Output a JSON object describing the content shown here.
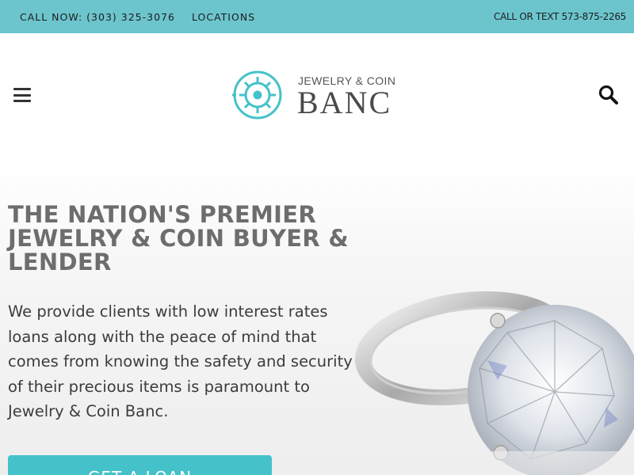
{
  "topbar": {
    "call_now": "CALL NOW: (303) 325-3076",
    "locations": "LOCATIONS",
    "call_or_text": "CALL OR TEXT 573-875-2265"
  },
  "header": {
    "logo_top": "JEWELRY & COIN",
    "logo_main": "BANC",
    "menu_icon": "hamburger-menu-icon",
    "search_icon": "magnifier-icon"
  },
  "hero": {
    "title": "THE NATION'S PREMIER JEWELRY & COIN BUYER & LENDER",
    "description": "We provide clients with low interest rates loans along with the peace of mind that comes from knowing the safety and security of their precious items is paramount to Jewelry & Coin Banc.",
    "cta_label": "GET A LOAN"
  },
  "colors": {
    "topbar_bg": "#6cc5cd",
    "logo_accent": "#45c2c9",
    "cta_bg": "#45c2c9",
    "title_text": "#6d6d6d"
  }
}
